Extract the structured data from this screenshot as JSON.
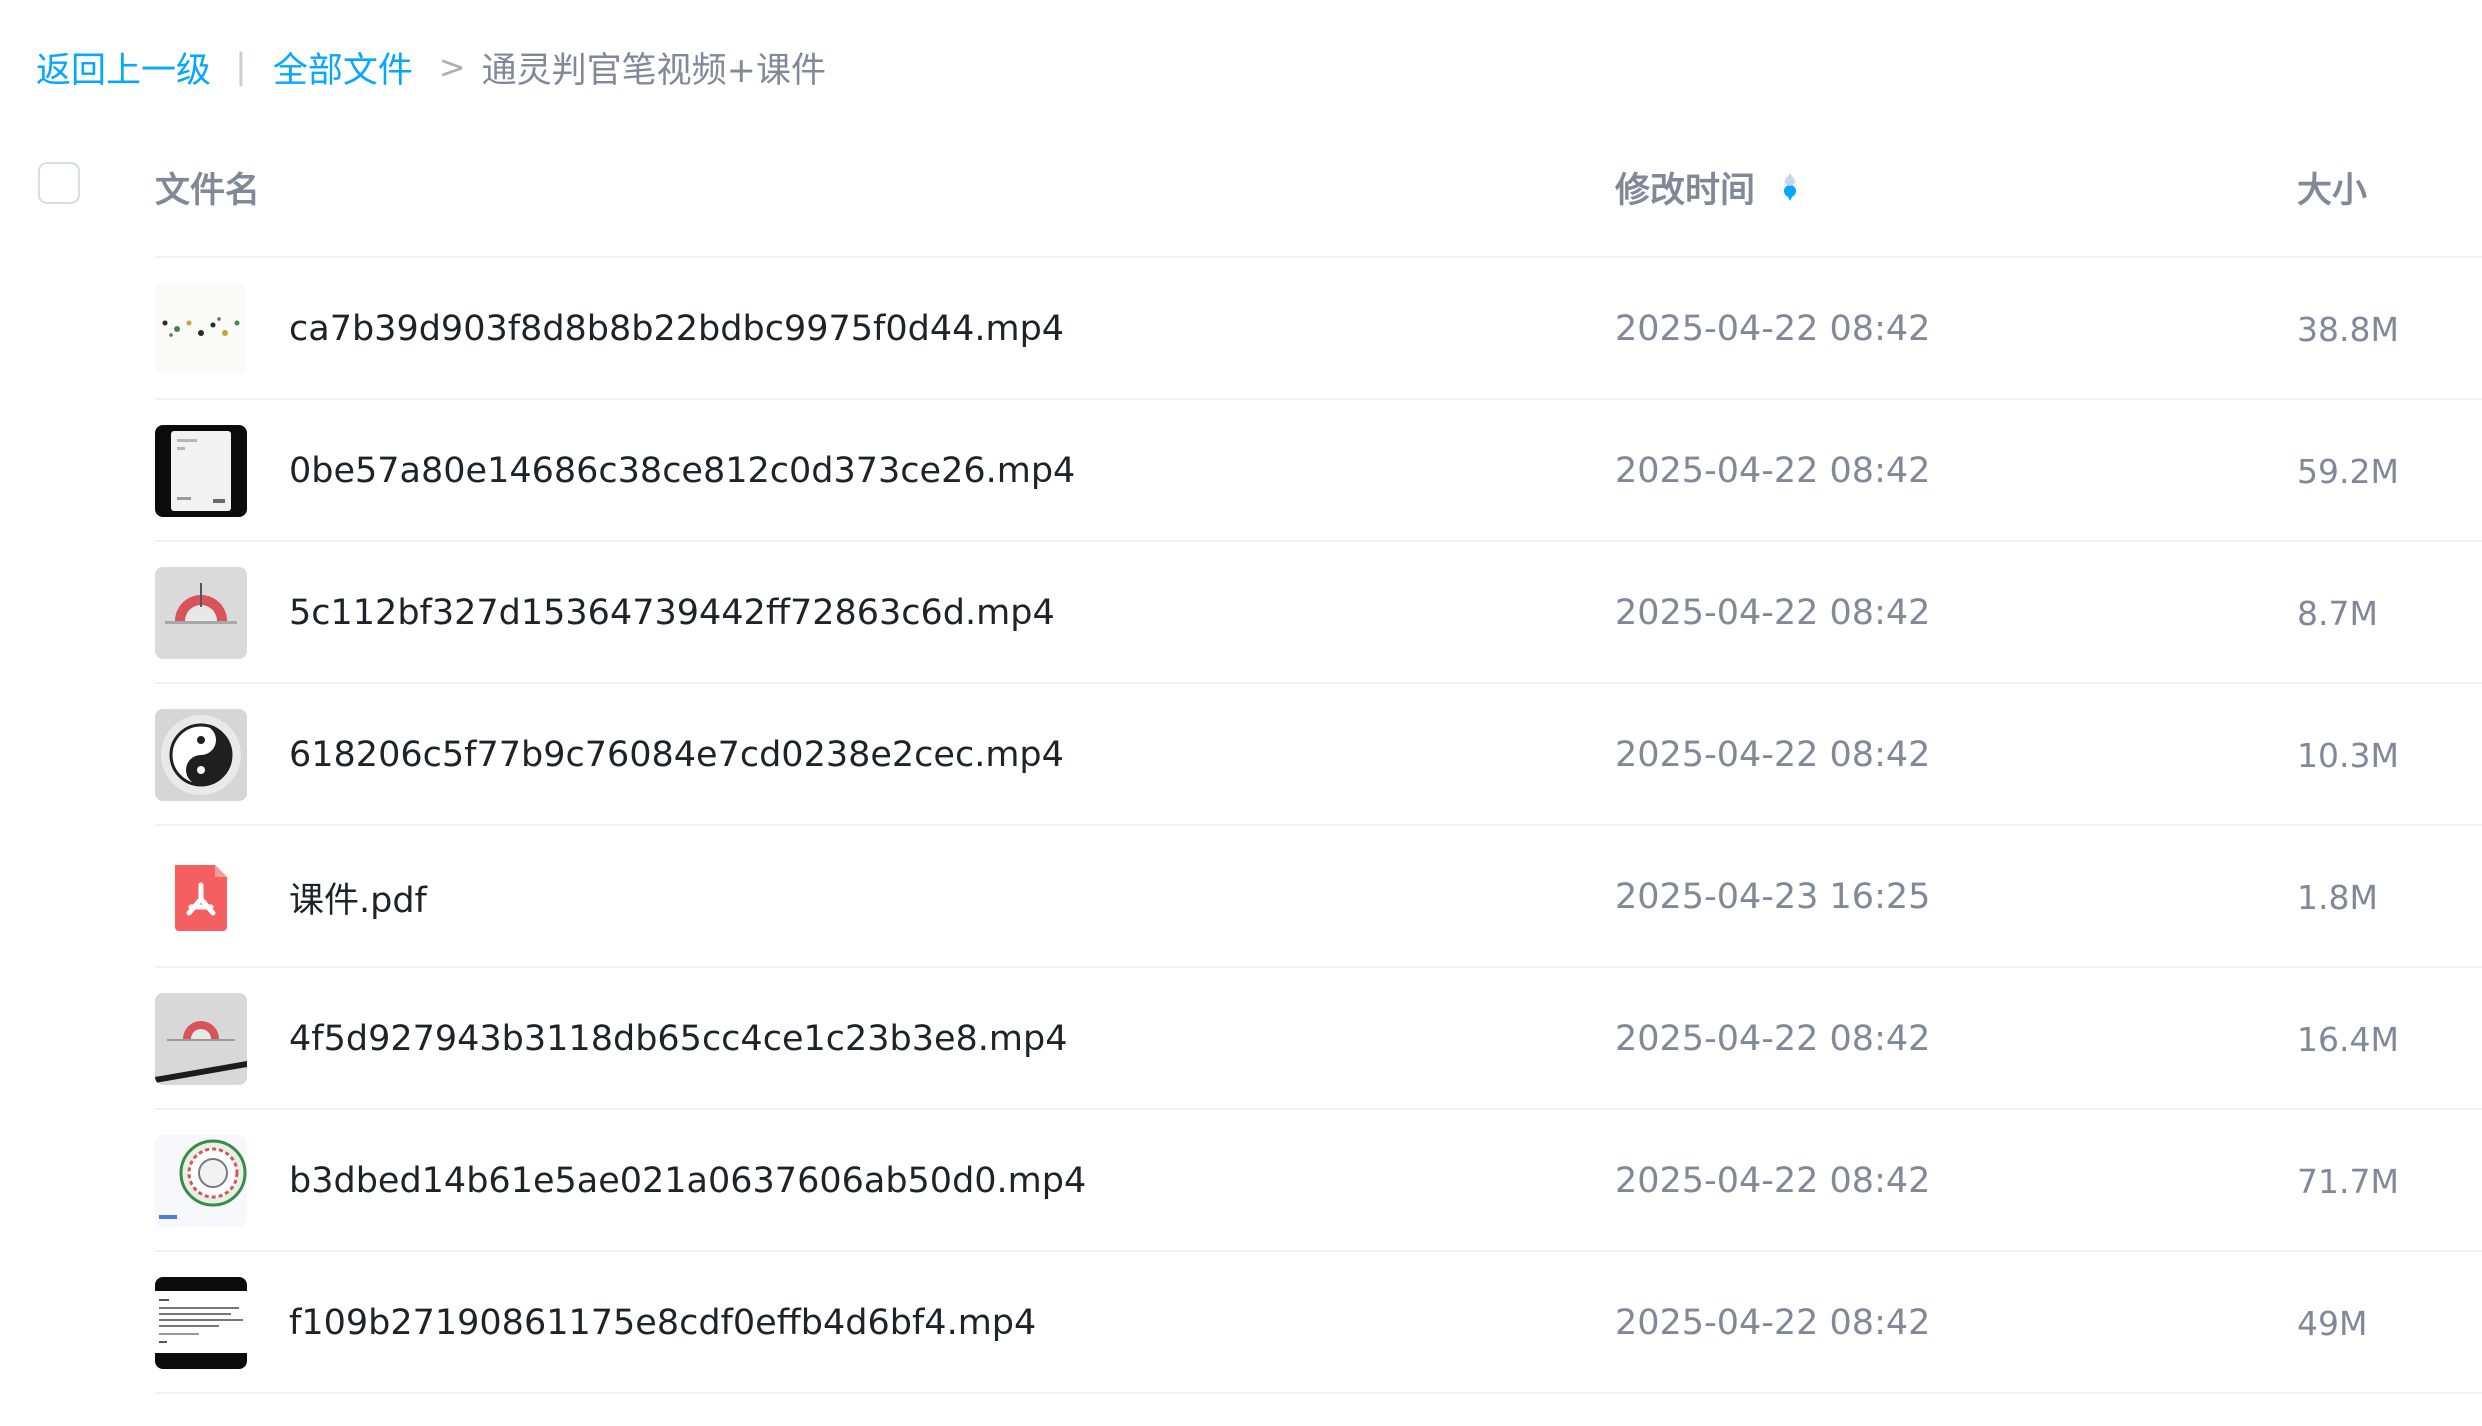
{
  "breadcrumb": {
    "back_label": "返回上一级",
    "divider": "|",
    "all_files_label": "全部文件",
    "separator": ">",
    "current_folder": "通灵判官笔视频+课件"
  },
  "table": {
    "columns": {
      "name": "文件名",
      "modified": "修改时间",
      "size": "大小"
    },
    "sort": {
      "column": "modified",
      "direction": "descending"
    }
  },
  "colors": {
    "accent": "#06a7ff",
    "secondary_text": "#818999",
    "pdf_icon": "#f45f5f"
  },
  "files": [
    {
      "name": "ca7b39d903f8d8b8b22bdbc9975f0d44.mp4",
      "modified": "2025-04-22 08:42",
      "size": "38.8M",
      "thumbnail": "video-thumbnail-dots"
    },
    {
      "name": "0be57a80e14686c38ce812c0d373ce26.mp4",
      "modified": "2025-04-22 08:42",
      "size": "59.2M",
      "thumbnail": "video-thumbnail-phone"
    },
    {
      "name": "5c112bf327d15364739442ff72863c6d.mp4",
      "modified": "2025-04-22 08:42",
      "size": "8.7M",
      "thumbnail": "video-thumbnail-protractor"
    },
    {
      "name": "618206c5f77b9c76084e7cd0238e2cec.mp4",
      "modified": "2025-04-22 08:42",
      "size": "10.3M",
      "thumbnail": "video-thumbnail-yinyang"
    },
    {
      "name": "课件.pdf",
      "modified": "2025-04-23 16:25",
      "size": "1.8M",
      "thumbnail": "pdf-icon"
    },
    {
      "name": "4f5d927943b3118db65cc4ce1c23b3e8.mp4",
      "modified": "2025-04-22 08:42",
      "size": "16.4M",
      "thumbnail": "video-thumbnail-protractor-pen"
    },
    {
      "name": "b3dbed14b61e5ae021a0637606ab50d0.mp4",
      "modified": "2025-04-22 08:42",
      "size": "71.7M",
      "thumbnail": "video-thumbnail-wheel"
    },
    {
      "name": "f109b27190861175e8cdf0effb4d6bf4.mp4",
      "modified": "2025-04-22 08:42",
      "size": "49M",
      "thumbnail": "video-thumbnail-document"
    }
  ]
}
